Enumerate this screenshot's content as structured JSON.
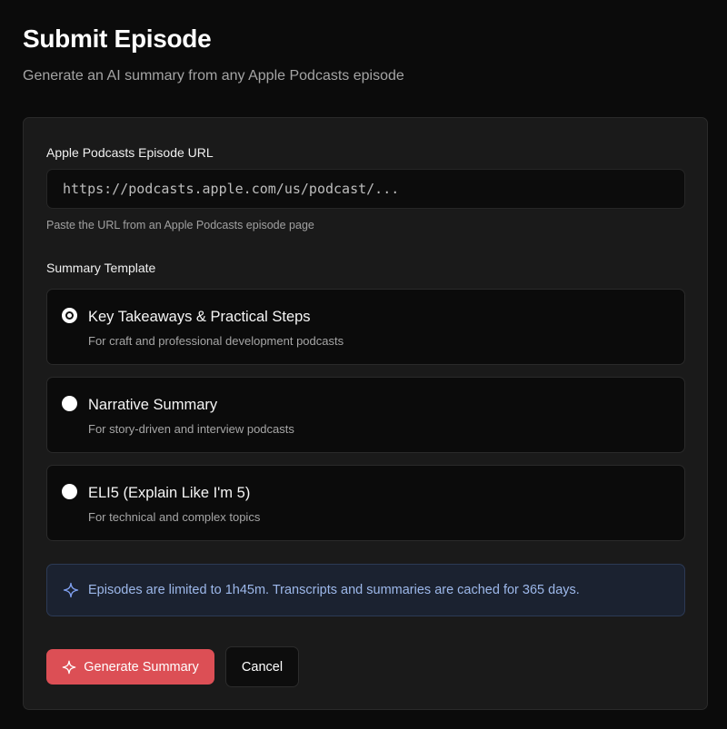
{
  "page": {
    "title": "Submit Episode",
    "subtitle": "Generate an AI summary from any Apple Podcasts episode"
  },
  "form": {
    "url_label": "Apple Podcasts Episode URL",
    "url_placeholder": "https://podcasts.apple.com/us/podcast/...",
    "url_value": "",
    "url_hint": "Paste the URL from an Apple Podcasts episode page",
    "template_label": "Summary Template",
    "templates": [
      {
        "title": "Key Takeaways & Practical Steps",
        "description": "For craft and professional development podcasts",
        "selected": true
      },
      {
        "title": "Narrative Summary",
        "description": "For story-driven and interview podcasts",
        "selected": false
      },
      {
        "title": "ELI5 (Explain Like I'm 5)",
        "description": "For technical and complex topics",
        "selected": false
      }
    ],
    "info_text": "Episodes are limited to 1h45m. Transcripts and summaries are cached for 365 days.",
    "info_icon": "sparkle-icon",
    "submit_label": "Generate Summary",
    "submit_icon": "sparkle-icon",
    "cancel_label": "Cancel"
  },
  "colors": {
    "primary": "#dc4f55",
    "info_bg": "#1b2230",
    "info_text": "#9db8ea",
    "background": "#0b0b0b",
    "card": "#1a1a1a"
  }
}
